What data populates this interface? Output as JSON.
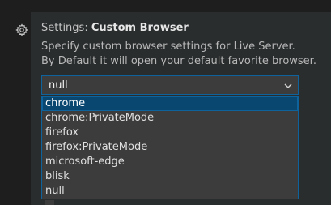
{
  "setting": {
    "category": "Settings: ",
    "name": "Custom Browser",
    "description_line1": "Specify custom browser settings for Live Server.",
    "description_line2": "By Default it will open your default favorite browser."
  },
  "select": {
    "value": "null",
    "options": [
      "chrome",
      "chrome:PrivateMode",
      "firefox",
      "firefox:PrivateMode",
      "microsoft-edge",
      "blisk",
      "null"
    ],
    "highlighted": "chrome"
  },
  "colors": {
    "background": "#1e1e1e",
    "row_hover": "#2a2d2e",
    "focus_border": "#0e639c",
    "selection": "#094771",
    "input_bg": "#3c3c3c"
  },
  "icons": {
    "gear": "gear-icon",
    "chevron": "chevron-down-icon"
  }
}
